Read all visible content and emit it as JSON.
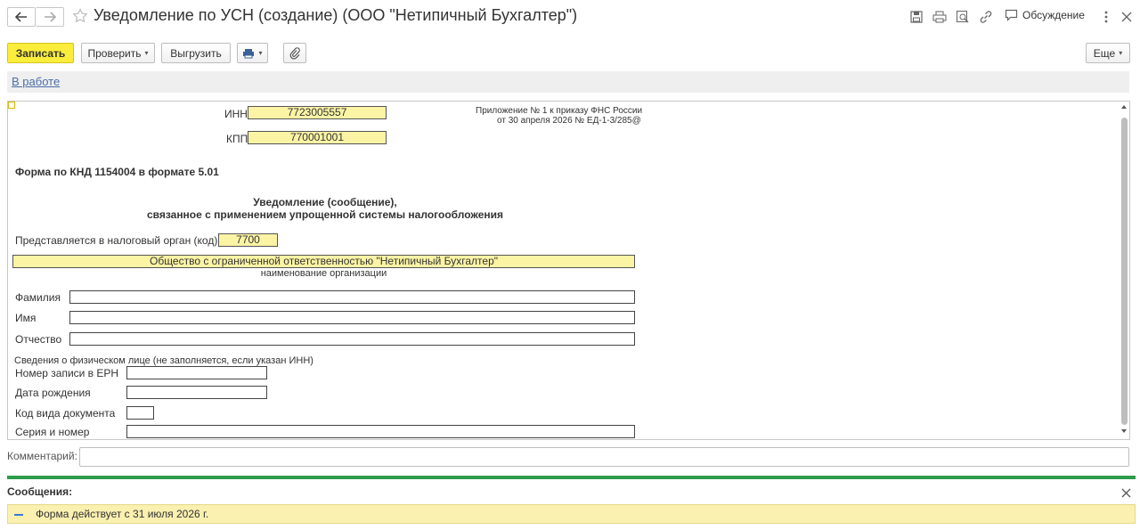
{
  "window": {
    "title": "Уведомление по УСН (создание) (ООО \"Нетипичный Бухгалтер\")",
    "discussion_label": "Обсуждение"
  },
  "toolbar": {
    "save_label": "Записать",
    "check_label": "Проверить",
    "export_label": "Выгрузить",
    "more_label": "Еще"
  },
  "status": {
    "link": "В работе"
  },
  "form": {
    "inn_label": "ИНН",
    "inn_value": "7723005557",
    "kpp_label": "КПП",
    "kpp_value": "770001001",
    "appendix_line1": "Приложение № 1 к приказу ФНС России",
    "appendix_line2": "от 30 апреля 2026 № ЕД-1-3/285@",
    "form_knd": "Форма по КНД 1154004 в формате 5.01",
    "heading_line1": "Уведомление (сообщение),",
    "heading_line2": "связанное с применением упрощенной системы налогообложения",
    "tax_authority_label": "Представляется в налоговый орган (код)",
    "tax_authority_code": "7700",
    "org_name": "Общество с ограниченной ответственностью \"Нетипичный Бухгалтер\"",
    "org_name_caption": "наименование организации",
    "surname_label": "Фамилия",
    "name_label": "Имя",
    "patronymic_label": "Отчество",
    "individual_section": "Сведения о физическом лице (не заполняется, если указан ИНН)",
    "ern_label": "Номер записи в ЕРН",
    "birth_label": "Дата рождения",
    "doc_type_label": "Код вида документа",
    "series_label": "Серия и номер"
  },
  "comment": {
    "label": "Комментарий:"
  },
  "messages": {
    "title": "Сообщения:",
    "text": "Форма действует с 31 июля 2026 г."
  }
}
